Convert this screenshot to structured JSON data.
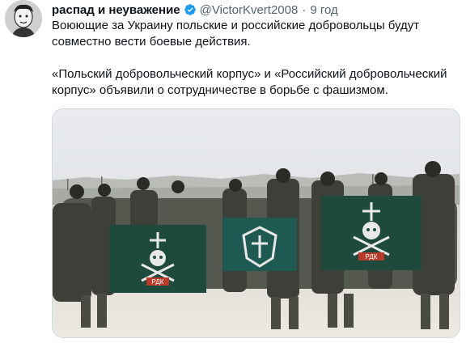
{
  "tweet": {
    "author_name": "распад и неуважение",
    "verified": true,
    "handle": "@VictorKvert2008",
    "separator": "·",
    "time": "9 год",
    "paragraphs": [
      "Воюющие за Украину польские и российские добровольцы будут совместно вести боевые действия.",
      "«Польский добровольческий корпус» и «Российский добровольческий корпус» объявили о сотрудничестве в борьбе с фашизмом."
    ]
  },
  "media": {
    "type": "photo",
    "flag_texts": [
      "РДК",
      "РДК"
    ]
  },
  "colors": {
    "verified_blue": "#1d9bf0",
    "secondary_text": "#536471",
    "flag_green": "#1e4a3e"
  }
}
